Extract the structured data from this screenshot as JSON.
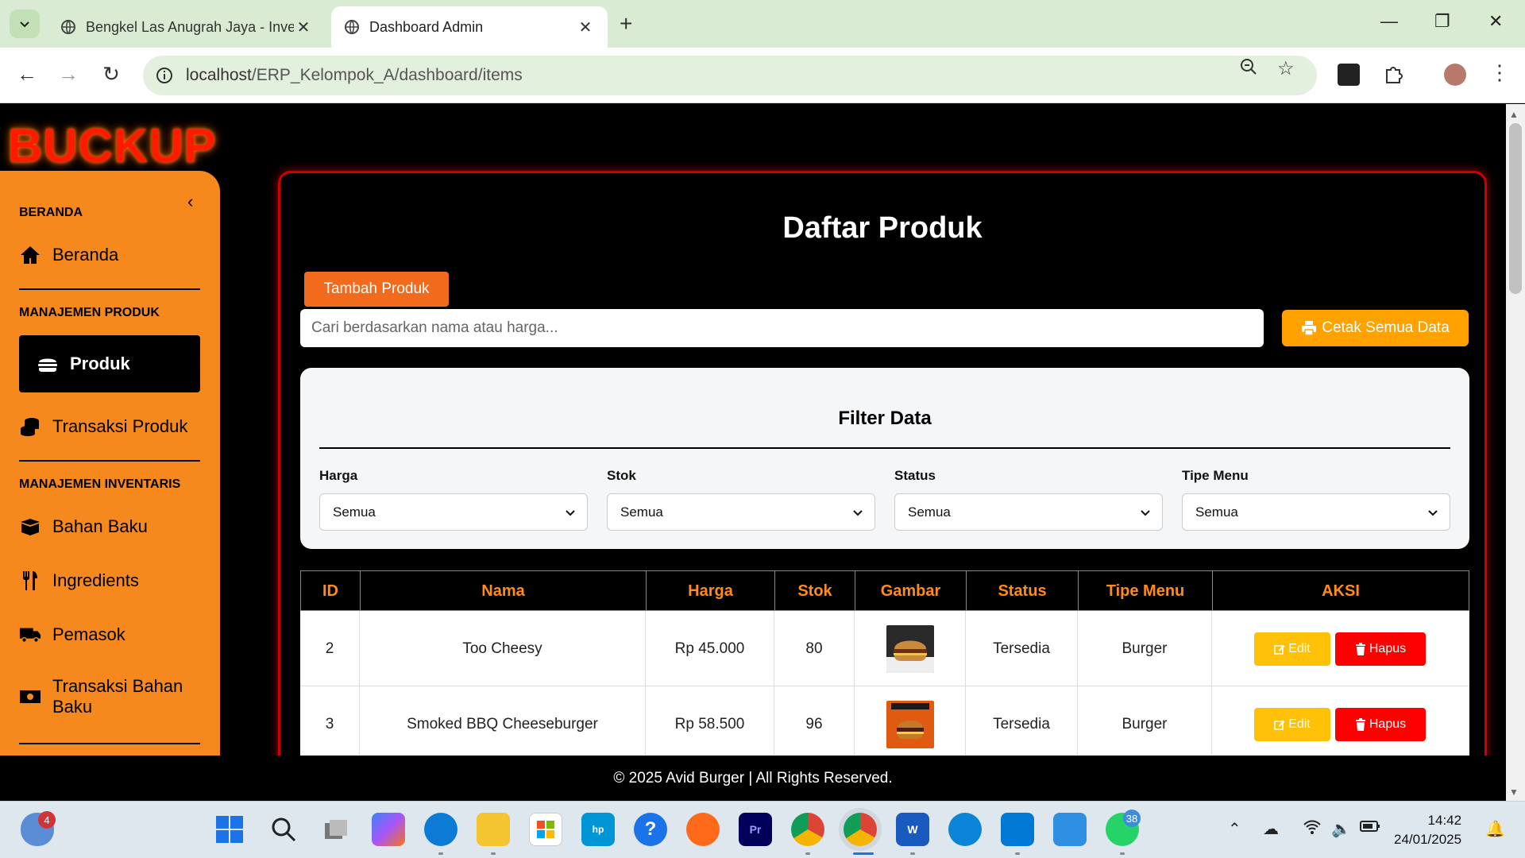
{
  "browser": {
    "tabs": [
      {
        "title": "Bengkel Las Anugrah Jaya - Inve",
        "active": false
      },
      {
        "title": "Dashboard Admin",
        "active": true
      }
    ],
    "url_host": "localhost",
    "url_path": "/ERP_Kelompok_A/dashboard/items"
  },
  "brand": "BUCKUP",
  "sidebar": {
    "sections": [
      "BERANDA",
      "MANAJEMEN PRODUK",
      "MANAJEMEN INVENTARIS"
    ],
    "items": [
      {
        "label": "Beranda",
        "icon": "home-icon"
      },
      {
        "label": "Produk",
        "icon": "burger-icon",
        "active": true
      },
      {
        "label": "Transaksi Produk",
        "icon": "coins-icon"
      },
      {
        "label": "Bahan Baku",
        "icon": "box-icon"
      },
      {
        "label": "Ingredients",
        "icon": "utensils-icon"
      },
      {
        "label": "Pemasok",
        "icon": "truck-icon"
      },
      {
        "label": "Transaksi Bahan Baku",
        "icon": "money-icon"
      }
    ],
    "collapse_glyph": "‹"
  },
  "main": {
    "title": "Daftar Produk",
    "add_button": "Tambah Produk",
    "search_placeholder": "Cari berdasarkan nama atau harga...",
    "print_button": "Cetak Semua Data",
    "filter": {
      "title": "Filter Data",
      "groups": [
        {
          "label": "Harga",
          "value": "Semua"
        },
        {
          "label": "Stok",
          "value": "Semua"
        },
        {
          "label": "Status",
          "value": "Semua"
        },
        {
          "label": "Tipe Menu",
          "value": "Semua"
        }
      ]
    },
    "table": {
      "headers": [
        "ID",
        "Nama",
        "Harga",
        "Stok",
        "Gambar",
        "Status",
        "Tipe Menu",
        "AKSI"
      ],
      "rows": [
        {
          "id": "2",
          "nama": "Too Cheesy",
          "harga": "Rp 45.000",
          "stok": "80",
          "status": "Tersedia",
          "tipe": "Burger"
        },
        {
          "id": "3",
          "nama": "Smoked BBQ Cheeseburger",
          "harga": "Rp 58.500",
          "stok": "96",
          "status": "Tersedia",
          "tipe": "Burger"
        }
      ],
      "edit_label": "Edit",
      "delete_label": "Hapus"
    }
  },
  "footer": "© 2025 Avid Burger | All Rights Reserved.",
  "taskbar": {
    "weather_badge": "4",
    "whatsapp_badge": "38",
    "time": "14:42",
    "date": "24/01/2025"
  },
  "colors": {
    "sidebar": "#f5891d",
    "accent_orange": "#f26b1d",
    "print_yellow": "#ffa200",
    "edit_yellow": "#ffc107",
    "delete_red": "#ff0000",
    "border_red": "#cc0000"
  }
}
